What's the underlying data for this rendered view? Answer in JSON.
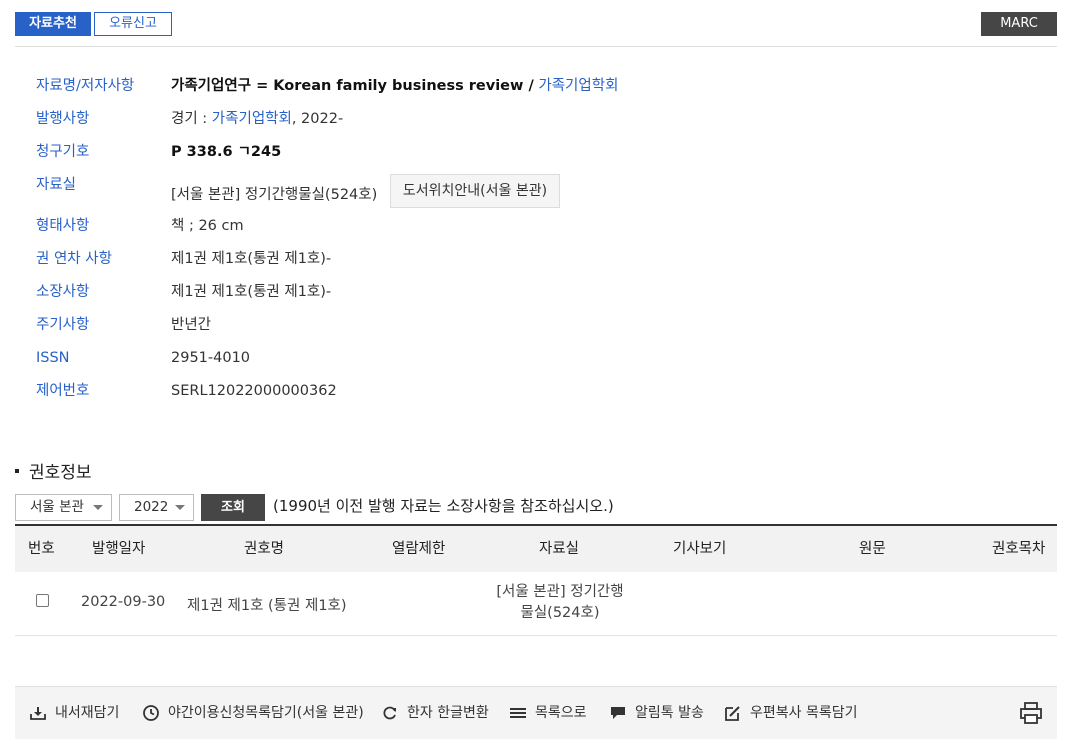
{
  "topbar": {
    "recommend_label": "자료추천",
    "report_label": "오류신고",
    "marc_label": "MARC"
  },
  "detail": {
    "title_label": "자료명/저자사항",
    "title_main": "가족기업연구 = Korean family business review /",
    "title_author": "가족기업학회",
    "publish_label": "발행사항",
    "publish_prefix": "경기 :",
    "publish_org": "가족기업학회",
    "publish_suffix": ", 2022-",
    "call_label": "청구기호",
    "call_value": "P 338.6 ㄱ245",
    "room_label": "자료실",
    "room_value": "[서울 본관] 정기간행물실(524호)",
    "room_button": "도서위치안내(서울 본관)",
    "form_label": "형태사항",
    "form_value": "책 ; 26 cm",
    "volume_label": "권 연차 사항",
    "volume_value": "제1권 제1호(통권 제1호)-",
    "holding_label": "소장사항",
    "holding_value": "제1권 제1호(통권 제1호)-",
    "note_label": "주기사항",
    "note_value": "반년간",
    "issn_label": "ISSN",
    "issn_value": "2951-4010",
    "control_label": "제어번호",
    "control_value": "SERL12022000000362"
  },
  "holdings": {
    "title": "권호정보",
    "branch_select": "서울 본관",
    "year_select": "2022",
    "search_label": "조회",
    "notice": "(1990년 이전 발행 자료는 소장사항을 참조하십시오.)",
    "columns": [
      "번호",
      "발행일자",
      "권호명",
      "열람제한",
      "자료실",
      "기사보기",
      "원문",
      "권호목차"
    ],
    "rows": [
      {
        "date": "2022-09-30",
        "issue": "제1권 제1호 (통권 제1호)",
        "room_line1": "[서울 본관] 정기간행",
        "room_line2": "물실(524호)"
      }
    ]
  },
  "toolbar": {
    "items": [
      "내서재담기",
      "야간이용신청목록담기(서울 본관)",
      "한자 한글변환",
      "목록으로",
      "알림톡 발송",
      "우편복사 목록담기"
    ]
  }
}
